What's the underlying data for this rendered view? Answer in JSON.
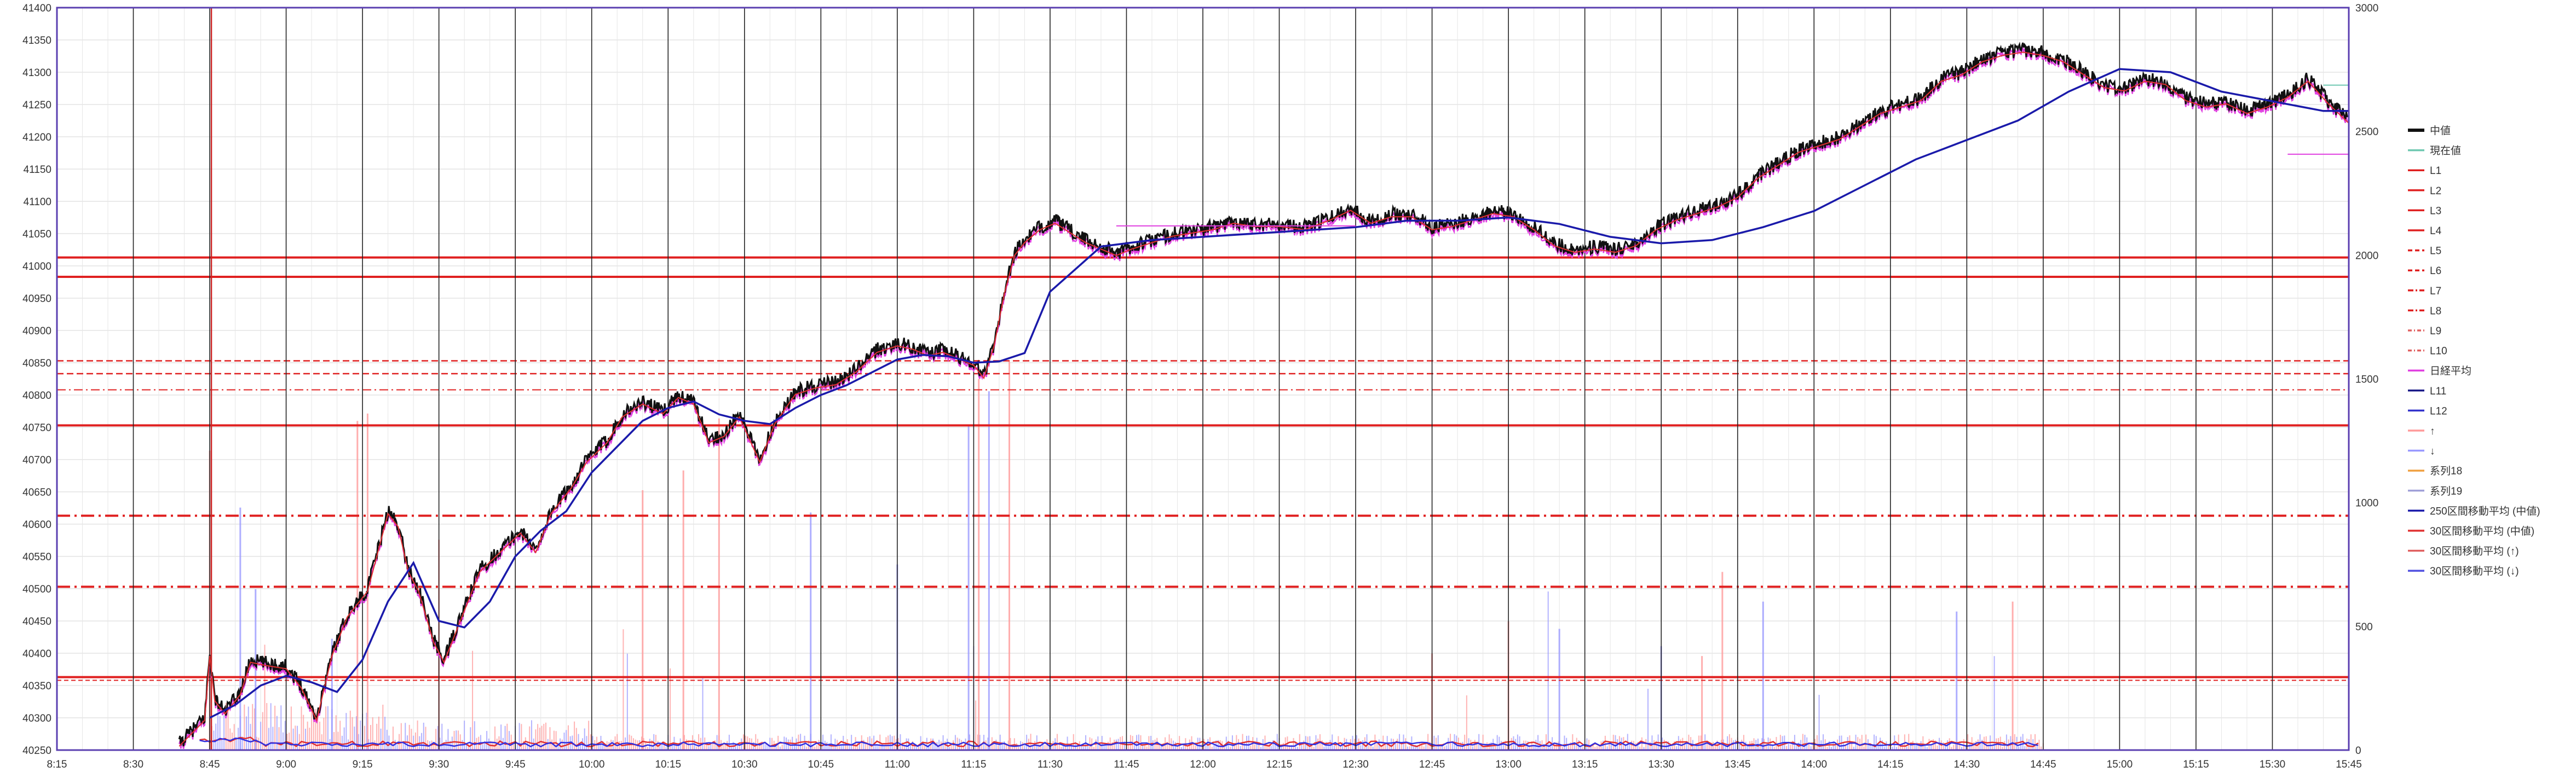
{
  "chart_data": {
    "type": "line",
    "title": "",
    "xlabel": "",
    "ylabel": "",
    "y_left_range": [
      40250,
      41400
    ],
    "y_right_range": [
      0,
      3000
    ],
    "y_left_ticks": [
      "40250",
      "40300",
      "40350",
      "40400",
      "40450",
      "40500",
      "40550",
      "40600",
      "40650",
      "40700",
      "40750",
      "40800",
      "40850",
      "40900",
      "40950",
      "41000",
      "41050",
      "41100",
      "41150",
      "41200",
      "41250",
      "41300",
      "41350",
      "41400"
    ],
    "y_right_ticks": [
      "0",
      "500",
      "1000",
      "1500",
      "2000",
      "2500",
      "3000"
    ],
    "x_ticks": [
      "8:15",
      "8:30",
      "8:45",
      "9:00",
      "9:15",
      "9:30",
      "9:45",
      "10:00",
      "10:15",
      "10:30",
      "10:45",
      "11:00",
      "11:15",
      "11:30",
      "11:45",
      "12:00",
      "12:15",
      "12:30",
      "12:45",
      "13:00",
      "13:15",
      "13:30",
      "13:45",
      "14:00",
      "14:15",
      "14:30",
      "14:45",
      "15:00",
      "15:15",
      "15:30",
      "15:45"
    ],
    "x_tick_minutes": [
      495,
      510,
      525,
      540,
      555,
      570,
      585,
      600,
      615,
      630,
      645,
      660,
      675,
      690,
      705,
      720,
      735,
      750,
      765,
      780,
      795,
      810,
      825,
      840,
      855,
      870,
      885,
      900,
      915,
      930,
      945
    ],
    "grid": true,
    "legend_position": "right",
    "horizontal_levels": [
      {
        "name": "L1",
        "value": 41013,
        "style": "solid",
        "color": "#e02020"
      },
      {
        "name": "L2",
        "value": 40983,
        "style": "solid",
        "color": "#e02020"
      },
      {
        "name": "L3",
        "value": 40753,
        "style": "solid",
        "color": "#e02020"
      },
      {
        "name": "L4",
        "value": 40363,
        "style": "solid",
        "color": "#e02020"
      },
      {
        "name": "L5",
        "value": 40853,
        "style": "dash",
        "color": "#e02020"
      },
      {
        "name": "L6",
        "value": 40833,
        "style": "dash",
        "color": "#e02020"
      },
      {
        "name": "L7",
        "value": 40613,
        "style": "dashdot",
        "color": "#e02020"
      },
      {
        "name": "L8",
        "value": 40503,
        "style": "dashdot",
        "color": "#e02020"
      },
      {
        "name": "L9",
        "value": 40808,
        "style": "dashdot-thin",
        "color": "#e02020"
      },
      {
        "name": "L10",
        "value": 40358,
        "style": "dash-thin",
        "color": "#e02020"
      }
    ],
    "time_markers": [
      {
        "time_minutes": 525,
        "color": "#cc2222"
      }
    ],
    "series": [
      {
        "name": "中値",
        "color": "#111111",
        "x_minutes": [
          519,
          524,
          525,
          526,
          528,
          531,
          533,
          536,
          540,
          543,
          546,
          549,
          552,
          554,
          556,
          558,
          560,
          562,
          564,
          566,
          569,
          571,
          574,
          578,
          582,
          586,
          589,
          592,
          596,
          599,
          603,
          606,
          610,
          614,
          617,
          620,
          623,
          626,
          629,
          633,
          636,
          640,
          644,
          648,
          652,
          656,
          660,
          663,
          666,
          669,
          672,
          675,
          677,
          679,
          681,
          683,
          685,
          688,
          691,
          694,
          697,
          700,
          703,
          706,
          710,
          714,
          718,
          722,
          726,
          730,
          735,
          740,
          745,
          749,
          753,
          757,
          761,
          765,
          769,
          773,
          777,
          781,
          785,
          789,
          793,
          797,
          801,
          805,
          809,
          813,
          817,
          821,
          825,
          829,
          833,
          837,
          841,
          845,
          849,
          853,
          857,
          861,
          865,
          869,
          873,
          877,
          881,
          885,
          889,
          893,
          897,
          901,
          905,
          909,
          913,
          917,
          921,
          925,
          929,
          933,
          937,
          941,
          945
        ],
        "values": [
          40260,
          40300,
          40400,
          40330,
          40310,
          40340,
          40390,
          40385,
          40380,
          40350,
          40300,
          40400,
          40460,
          40480,
          40500,
          40560,
          40620,
          40600,
          40530,
          40500,
          40420,
          40390,
          40450,
          40530,
          40560,
          40590,
          40560,
          40620,
          40660,
          40700,
          40730,
          40770,
          40790,
          40775,
          40800,
          40790,
          40730,
          40740,
          40770,
          40700,
          40760,
          40805,
          40815,
          40820,
          40840,
          40870,
          40880,
          40875,
          40865,
          40870,
          40860,
          40850,
          40830,
          40880,
          40960,
          41020,
          41040,
          41060,
          41070,
          41055,
          41040,
          41030,
          41020,
          41030,
          41040,
          41050,
          41055,
          41060,
          41070,
          41065,
          41065,
          41060,
          41075,
          41090,
          41070,
          41080,
          41080,
          41060,
          41065,
          41075,
          41085,
          41080,
          41060,
          41035,
          41025,
          41030,
          41025,
          41035,
          41060,
          41075,
          41085,
          41095,
          41110,
          41140,
          41160,
          41180,
          41190,
          41200,
          41220,
          41240,
          41250,
          41260,
          41290,
          41300,
          41320,
          41330,
          41335,
          41330,
          41320,
          41300,
          41280,
          41275,
          41290,
          41285,
          41260,
          41250,
          41255,
          41240,
          41250,
          41265,
          41290,
          41255,
          41225
        ]
      },
      {
        "name": "250区間移動平均(中値)",
        "color": "#1a1aaa",
        "x_minutes": [
          525,
          530,
          535,
          540,
          545,
          550,
          555,
          560,
          565,
          570,
          575,
          580,
          585,
          590,
          595,
          600,
          605,
          610,
          615,
          620,
          625,
          630,
          635,
          640,
          645,
          650,
          655,
          660,
          665,
          670,
          675,
          680,
          685,
          690,
          700,
          710,
          720,
          730,
          740,
          750,
          760,
          770,
          780,
          790,
          800,
          810,
          820,
          830,
          840,
          850,
          860,
          870,
          880,
          890,
          900,
          910,
          920,
          930,
          940,
          945
        ],
        "values": [
          40300,
          40320,
          40350,
          40365,
          40355,
          40340,
          40390,
          40480,
          40540,
          40450,
          40440,
          40480,
          40550,
          40590,
          40620,
          40680,
          40720,
          40760,
          40780,
          40790,
          40770,
          40760,
          40755,
          40780,
          40800,
          40815,
          40835,
          40855,
          40862,
          40860,
          40850,
          40852,
          40865,
          40960,
          41030,
          41040,
          41045,
          41050,
          41055,
          41060,
          41070,
          41070,
          41075,
          41065,
          41045,
          41035,
          41040,
          41060,
          41085,
          41125,
          41165,
          41195,
          41225,
          41270,
          41305,
          41300,
          41270,
          41255,
          41240,
          41240
        ]
      }
    ]
  },
  "legend": {
    "items": [
      {
        "label": "中値",
        "color": "#111111",
        "style": "solid-thick"
      },
      {
        "label": "現在値",
        "color": "#6ec8b0",
        "style": "solid"
      },
      {
        "label": "L1",
        "color": "#e02020",
        "style": "solid"
      },
      {
        "label": "L2",
        "color": "#e02020",
        "style": "solid"
      },
      {
        "label": "L3",
        "color": "#e02020",
        "style": "solid"
      },
      {
        "label": "L4",
        "color": "#e02020",
        "style": "solid"
      },
      {
        "label": "L5",
        "color": "#e02020",
        "style": "dash"
      },
      {
        "label": "L6",
        "color": "#e02020",
        "style": "dash"
      },
      {
        "label": "L7",
        "color": "#e02020",
        "style": "dashdot"
      },
      {
        "label": "L8",
        "color": "#e02020",
        "style": "dashdot"
      },
      {
        "label": "L9",
        "color": "#e06060",
        "style": "dashdot-thin"
      },
      {
        "label": "L10",
        "color": "#e06060",
        "style": "dashdot-thin"
      },
      {
        "label": "日経平均",
        "color": "#e040e0",
        "style": "solid"
      },
      {
        "label": "L11",
        "color": "#1a1a88",
        "style": "solid"
      },
      {
        "label": "L12",
        "color": "#3333cc",
        "style": "solid"
      },
      {
        "label": "↑",
        "color": "#ff9999",
        "style": "solid"
      },
      {
        "label": "↓",
        "color": "#9999ff",
        "style": "solid"
      },
      {
        "label": "系列18",
        "color": "#f0a040",
        "style": "solid"
      },
      {
        "label": "系列19",
        "color": "#a0a0d8",
        "style": "solid"
      },
      {
        "label": "250区間移動平均 (中値)",
        "color": "#1a1aaa",
        "style": "solid"
      },
      {
        "label": "30区間移動平均 (中値)",
        "color": "#e03030",
        "style": "solid"
      },
      {
        "label": "30区間移動平均 (↑)",
        "color": "#e06060",
        "style": "solid"
      },
      {
        "label": "30区間移動平均 (↓)",
        "color": "#5050e0",
        "style": "solid"
      }
    ]
  },
  "colors": {
    "frame": "#5a3fb0",
    "grid_major": "#d6d6d6",
    "vline": "#222222",
    "volume_up": "#ff9a9a",
    "volume_down": "#9a9aff",
    "volume_mix": "#b49ad6"
  }
}
